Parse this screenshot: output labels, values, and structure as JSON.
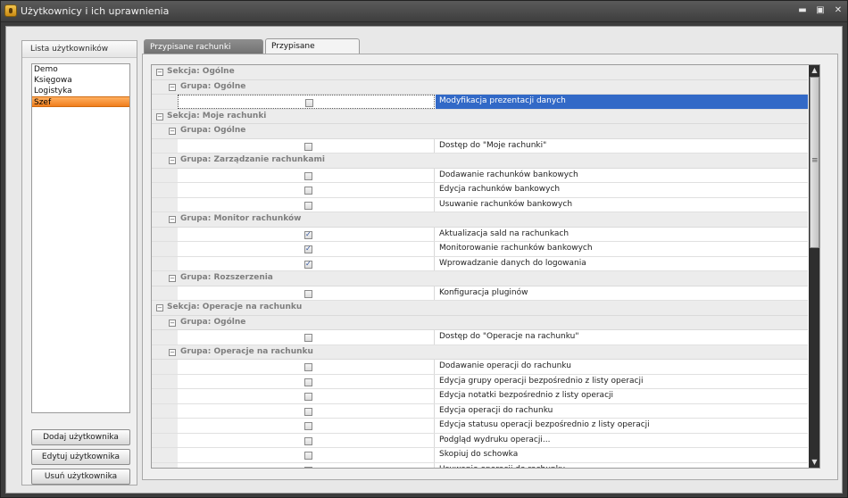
{
  "window": {
    "title": "Użytkownicy i ich uprawnienia"
  },
  "users": {
    "header": "Lista użytkowników",
    "items": [
      "Demo",
      "Księgowa",
      "Logistyka",
      "Szef"
    ],
    "selected_index": 3,
    "buttons": {
      "add": "Dodaj użytkownika",
      "edit": "Edytuj użytkownika",
      "delete": "Usuń użytkownika"
    }
  },
  "tabs": [
    "Przypisane rachunki bankowe",
    "Przypisane uprawnienia"
  ],
  "permissions": [
    {
      "kind": "section",
      "text": "Sekcja: Ogólne"
    },
    {
      "kind": "group",
      "text": "Grupa: Ogólne"
    },
    {
      "kind": "item",
      "label": "Modyfikacja prezentacji danych",
      "checked": false,
      "selected": true
    },
    {
      "kind": "section",
      "text": "Sekcja: Moje rachunki"
    },
    {
      "kind": "group",
      "text": "Grupa: Ogólne"
    },
    {
      "kind": "item",
      "label": "Dostęp do \"Moje rachunki\"",
      "checked": false
    },
    {
      "kind": "group",
      "text": "Grupa: Zarządzanie rachunkami"
    },
    {
      "kind": "item",
      "label": "Dodawanie rachunków bankowych",
      "checked": false
    },
    {
      "kind": "item",
      "label": "Edycja rachunków bankowych",
      "checked": false
    },
    {
      "kind": "item",
      "label": "Usuwanie rachunków bankowych",
      "checked": false
    },
    {
      "kind": "group",
      "text": "Grupa: Monitor rachunków"
    },
    {
      "kind": "item",
      "label": "Aktualizacja sald na rachunkach",
      "checked": true
    },
    {
      "kind": "item",
      "label": "Monitorowanie rachunków bankowych",
      "checked": true
    },
    {
      "kind": "item",
      "label": "Wprowadzanie danych do logowania",
      "checked": true
    },
    {
      "kind": "group",
      "text": "Grupa: Rozszerzenia"
    },
    {
      "kind": "item",
      "label": "Konfiguracja pluginów",
      "checked": false
    },
    {
      "kind": "section",
      "text": "Sekcja: Operacje na rachunku"
    },
    {
      "kind": "group",
      "text": "Grupa: Ogólne"
    },
    {
      "kind": "item",
      "label": "Dostęp do \"Operacje na rachunku\"",
      "checked": false
    },
    {
      "kind": "group",
      "text": "Grupa: Operacje na rachunku"
    },
    {
      "kind": "item",
      "label": "Dodawanie operacji do rachunku",
      "checked": false
    },
    {
      "kind": "item",
      "label": "Edycja grupy operacji bezpośrednio z listy operacji",
      "checked": false
    },
    {
      "kind": "item",
      "label": "Edycja notatki bezpośrednio z listy operacji",
      "checked": false
    },
    {
      "kind": "item",
      "label": "Edycja operacji do rachunku",
      "checked": false
    },
    {
      "kind": "item",
      "label": "Edycja statusu operacji bezpośrednio z listy operacji",
      "checked": false
    },
    {
      "kind": "item",
      "label": "Podgląd wydruku operacji...",
      "checked": false
    },
    {
      "kind": "item",
      "label": "Skopiuj do schowka",
      "checked": false
    },
    {
      "kind": "item",
      "label": "Usuwanie operacji do rachunku",
      "checked": false
    }
  ]
}
